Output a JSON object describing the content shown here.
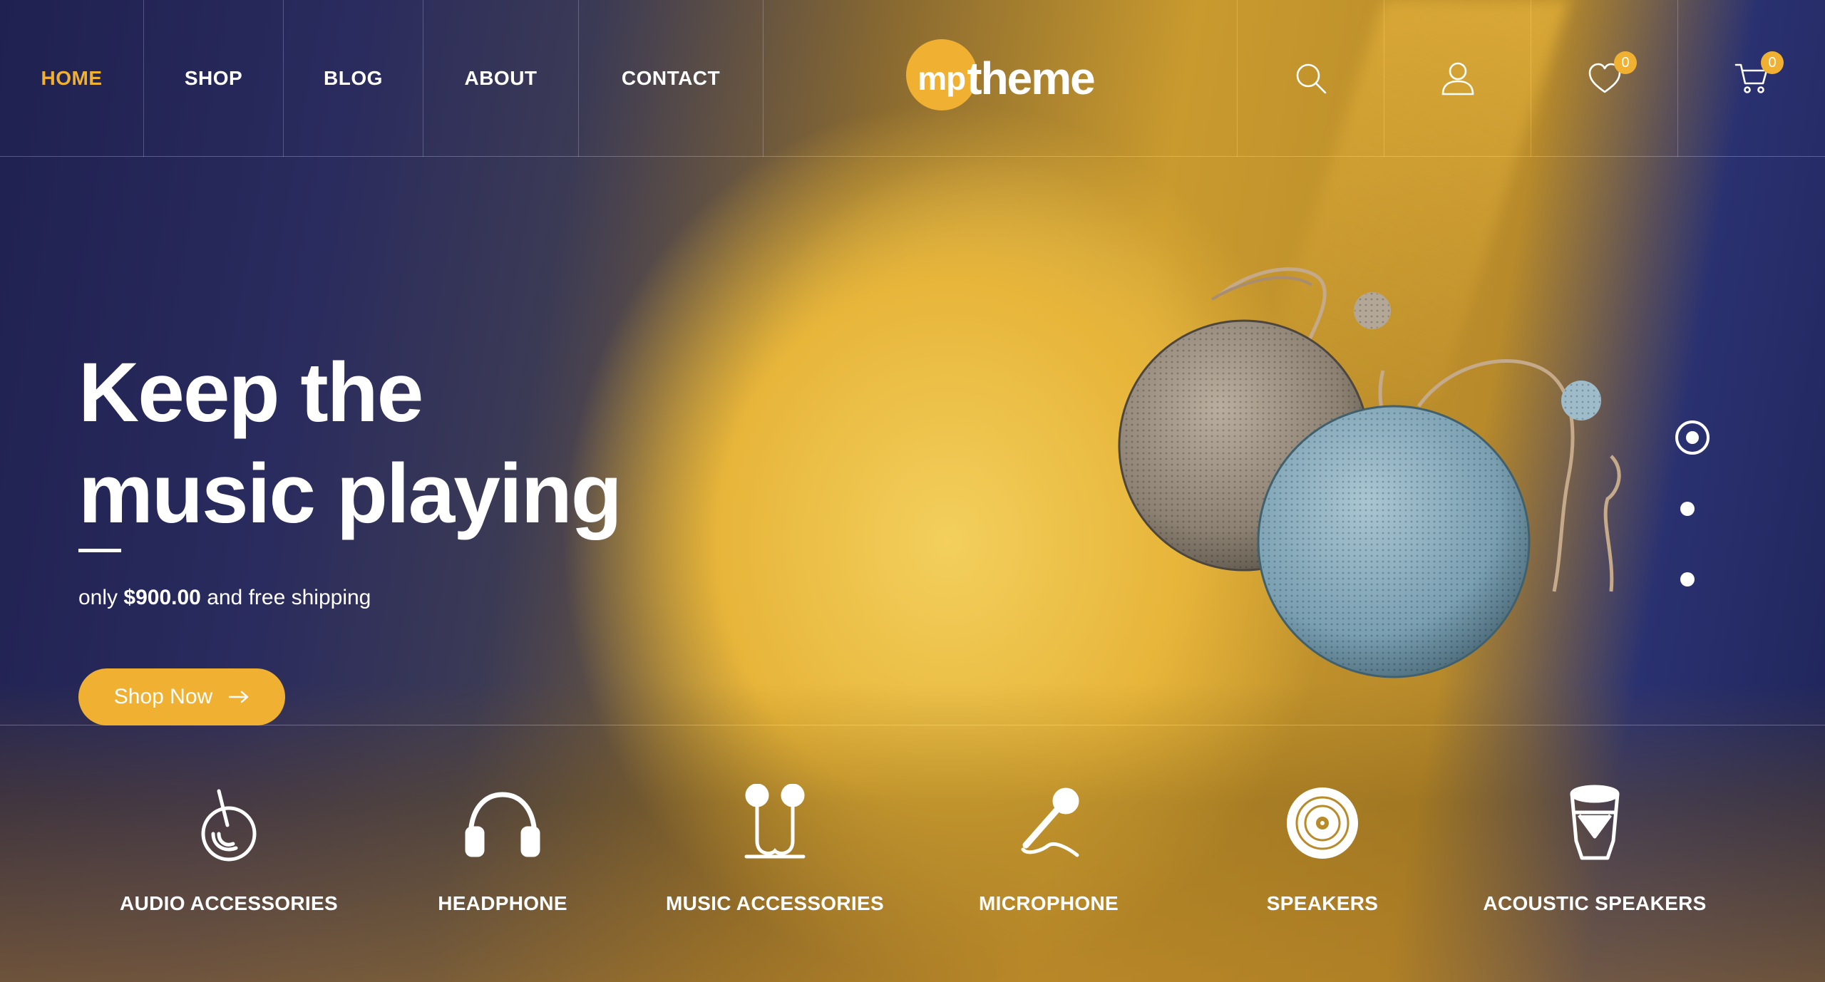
{
  "nav": {
    "items": [
      {
        "label": "HOME",
        "active": true
      },
      {
        "label": "SHOP"
      },
      {
        "label": "BLOG"
      },
      {
        "label": "ABOUT"
      },
      {
        "label": "CONTACT"
      }
    ]
  },
  "logo": {
    "mp": "mp",
    "theme": "theme"
  },
  "header_icons": {
    "search": {
      "icon": "search-icon"
    },
    "account": {
      "icon": "user-icon"
    },
    "wishlist": {
      "icon": "heart-icon",
      "count": "0"
    },
    "cart": {
      "icon": "cart-icon",
      "count": "0"
    }
  },
  "hero": {
    "title_line1": "Keep the",
    "title_line2": "music playing",
    "sub_prefix": "only",
    "price": "$900.00",
    "sub_suffix": "and free shipping",
    "button_label": "Shop Now"
  },
  "slider": {
    "active_index": 1,
    "total": 3
  },
  "categories": [
    {
      "label": "AUDIO ACCESSORIES",
      "icon": "audio-accessories-icon"
    },
    {
      "label": "HEADPHONE",
      "icon": "headphone-icon"
    },
    {
      "label": "MUSIC ACCESSORIES",
      "icon": "earbuds-icon"
    },
    {
      "label": "MICROPHONE",
      "icon": "microphone-icon"
    },
    {
      "label": "SPEAKERS",
      "icon": "disc-icon"
    },
    {
      "label": "ACOUSTIC SPEAKERS",
      "icon": "drum-icon"
    }
  ],
  "colors": {
    "accent": "#f0b132",
    "text": "#ffffff",
    "navy": "#1f2150"
  }
}
